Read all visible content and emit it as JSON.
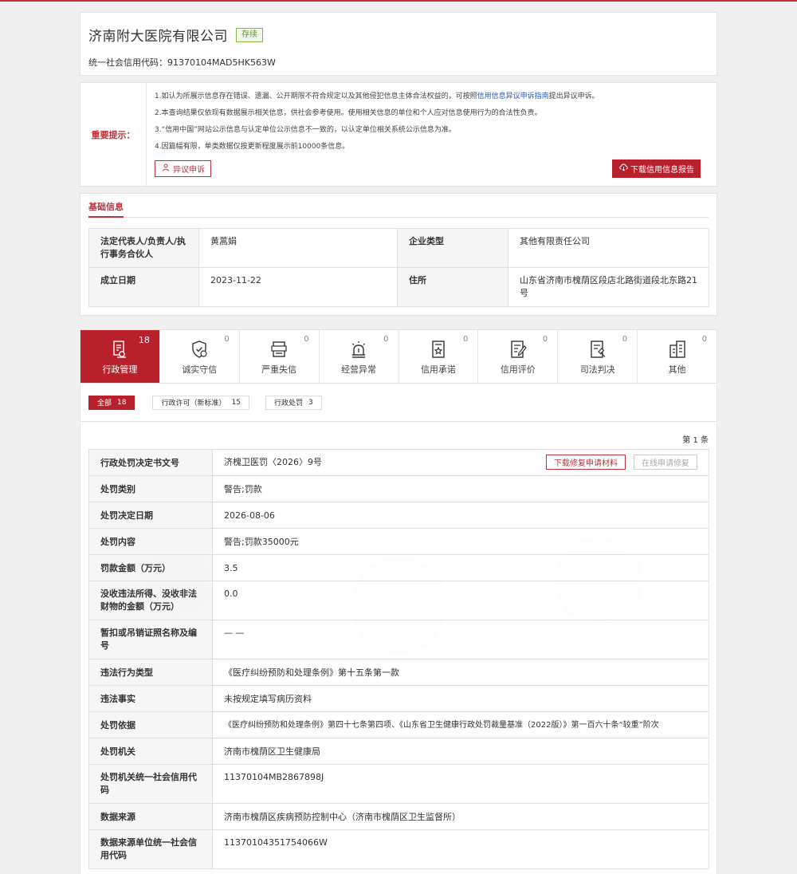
{
  "company": {
    "name": "济南附大医院有限公司",
    "status": "存续",
    "credit_code_label": "统一社会信用代码：",
    "credit_code": "91370104MAD5HK563W"
  },
  "notice": {
    "label": "重要提示：",
    "line1_pre": "1.如认为所展示信息存在错误、遗漏、公开期限不符合规定以及其他侵犯信息主体合法权益的，可按照",
    "line1_link": "信用信息异议申诉指南",
    "line1_post": "提出异议申诉。",
    "line2": "2.本查询结果仅依现有数据展示相关信息，供社会参考使用。使用相关信息的单位和个人应对信息使用行为的合法性负责。",
    "line3": "3.“信用中国”网站公示信息与认定单位公示信息不一致的，以认定单位相关系统公示信息为准。",
    "line4": "4.因篇幅有限，单类数据仅按更新程度展示前10000条信息。",
    "appeal_btn": "异议申诉",
    "download_btn": "下载信用信息报告"
  },
  "basic": {
    "tab": "基础信息",
    "rows": [
      {
        "l1": "法定代表人/负责人/执行事务合伙人",
        "v1": "黄蒿娟",
        "l2": "企业类型",
        "v2": "其他有限责任公司"
      },
      {
        "l1": "成立日期",
        "v1": "2023-11-22",
        "l2": "住所",
        "v2": "山东省济南市槐荫区段店北路街道段北东路21号"
      }
    ]
  },
  "categories": [
    {
      "label": "行政管理",
      "count": "18",
      "icon": "admin-icon"
    },
    {
      "label": "诚实守信",
      "count": "0",
      "icon": "shield-icon"
    },
    {
      "label": "严重失信",
      "count": "0",
      "icon": "dishonest-icon"
    },
    {
      "label": "经营异常",
      "count": "0",
      "icon": "alarm-icon"
    },
    {
      "label": "信用承诺",
      "count": "0",
      "icon": "promise-icon"
    },
    {
      "label": "信用评价",
      "count": "0",
      "icon": "evaluation-icon"
    },
    {
      "label": "司法判决",
      "count": "0",
      "icon": "judgment-icon"
    },
    {
      "label": "其他",
      "count": "0",
      "icon": "other-icon"
    }
  ],
  "filters": [
    {
      "label": "全部",
      "count": "18"
    },
    {
      "label": "行政许可（新标准）",
      "count": "15"
    },
    {
      "label": "行政处罚",
      "count": "3"
    }
  ],
  "detail": {
    "page_label": "第 1 条",
    "download_repair_btn": "下载修复申请材料",
    "online_repair_btn": "在线申请修复",
    "rows": [
      {
        "label": "行政处罚决定书文号",
        "value": "济槐卫医罚〈2026〉9号"
      },
      {
        "label": "处罚类别",
        "value": "警告;罚款"
      },
      {
        "label": "处罚决定日期",
        "value": "2026-08-06"
      },
      {
        "label": "处罚内容",
        "value": "警告;罚款35000元"
      },
      {
        "label": "罚款金额（万元）",
        "value": "3.5"
      },
      {
        "label": "没收违法所得、没收非法财物的金额（万元）",
        "value": "0.0"
      },
      {
        "label": "暂扣或吊销证照名称及编号",
        "value": "— —"
      },
      {
        "label": "违法行为类型",
        "value": "《医疗纠纷预防和处理条例》第十五条第一款"
      },
      {
        "label": "违法事实",
        "value": "未按规定填写病历资料"
      },
      {
        "label": "处罚依据",
        "value": "《医疗纠纷预防和处理条例》第四十七条第四项、《山东省卫生健康行政处罚裁量基准（2022版）》第一百六十条“较重”阶次"
      },
      {
        "label": "处罚机关",
        "value": "济南市槐荫区卫生健康局"
      },
      {
        "label": "处罚机关统一社会信用代码",
        "value": "11370104MB2867898J"
      },
      {
        "label": "数据来源",
        "value": "济南市槐荫区疾病预防控制中心（济南市槐荫区卫生监督所）"
      },
      {
        "label": "数据来源单位统一社会信用代码",
        "value": "11370104351754066W"
      }
    ]
  },
  "colors": {
    "brand": "#b8202c",
    "status": "#86b942",
    "link": "#2c58b6"
  }
}
